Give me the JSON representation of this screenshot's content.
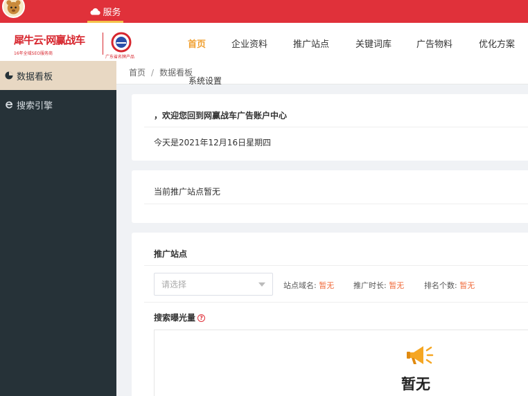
{
  "topbar": {
    "service_label": "服务"
  },
  "logo": {
    "brand": "犀牛云·网赢战车",
    "brand_sub": "16年全域SEO服务商",
    "seal_text": "广东省名牌产品"
  },
  "nav": {
    "items": [
      {
        "label": "首页",
        "active": true
      },
      {
        "label": "企业资料"
      },
      {
        "label": "推广站点"
      },
      {
        "label": "关键词库"
      },
      {
        "label": "广告物料"
      },
      {
        "label": "优化方案"
      }
    ],
    "overflow_item": "系统设置"
  },
  "sidebar": {
    "items": [
      {
        "label": "数据看板",
        "icon": "pie-chart-icon",
        "active": true
      },
      {
        "label": "搜索引擎",
        "icon": "ie-icon"
      }
    ]
  },
  "breadcrumb": {
    "home": "首页",
    "sep": "/",
    "current": "数据看板"
  },
  "welcome": {
    "greeting": "，欢迎您回到网赢战车广告账户中心",
    "date_line": "今天是2021年12月16日星期四"
  },
  "site_status": {
    "text": "当前推广站点暂无"
  },
  "promo": {
    "title": "推广站点",
    "select_placeholder": "请选择",
    "domain_label": "站点域名:",
    "domain_value": "暂无",
    "duration_label": "推广时长:",
    "duration_value": "暂无",
    "rank_label": "排名个数:",
    "rank_value": "暂无",
    "exposure_title": "搜索曝光量",
    "help_glyph": "?",
    "empty_text": "暂无"
  },
  "colors": {
    "topbar": "#e0313a",
    "sidebar": "#263238",
    "sidebar_active": "#e8d8c3",
    "nav_active": "#f0a030",
    "value_orange": "#f06a3a"
  }
}
